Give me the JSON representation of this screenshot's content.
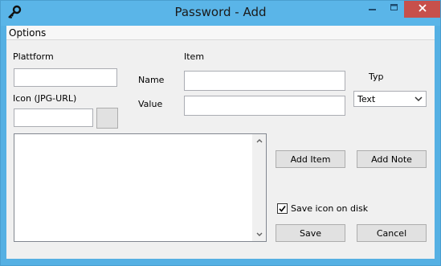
{
  "window": {
    "title": "Password - Add",
    "icon": "key-icon",
    "controls": {
      "minimize": "minimize-icon",
      "maximize": "maximize-icon",
      "close": "close-icon"
    },
    "colors": {
      "titlebar": "#5ab5e8",
      "close": "#c7504b"
    }
  },
  "menu": {
    "items": [
      {
        "label": "Options"
      }
    ]
  },
  "form": {
    "plattform_label": "Plattform",
    "plattform_value": "",
    "icon_label": "Icon (JPG-URL)",
    "icon_value": "",
    "icon_browse_label": "",
    "item_label": "Item",
    "name_label": "Name",
    "name_value": "",
    "value_label": "Value",
    "value_value": "",
    "typ_label": "Typ",
    "typ_selected": "Text",
    "notes_value": ""
  },
  "buttons": {
    "add_item": "Add Item",
    "add_note": "Add Note",
    "save": "Save",
    "cancel": "Cancel"
  },
  "save_icon": {
    "label": "Save icon on disk",
    "checked": true
  }
}
